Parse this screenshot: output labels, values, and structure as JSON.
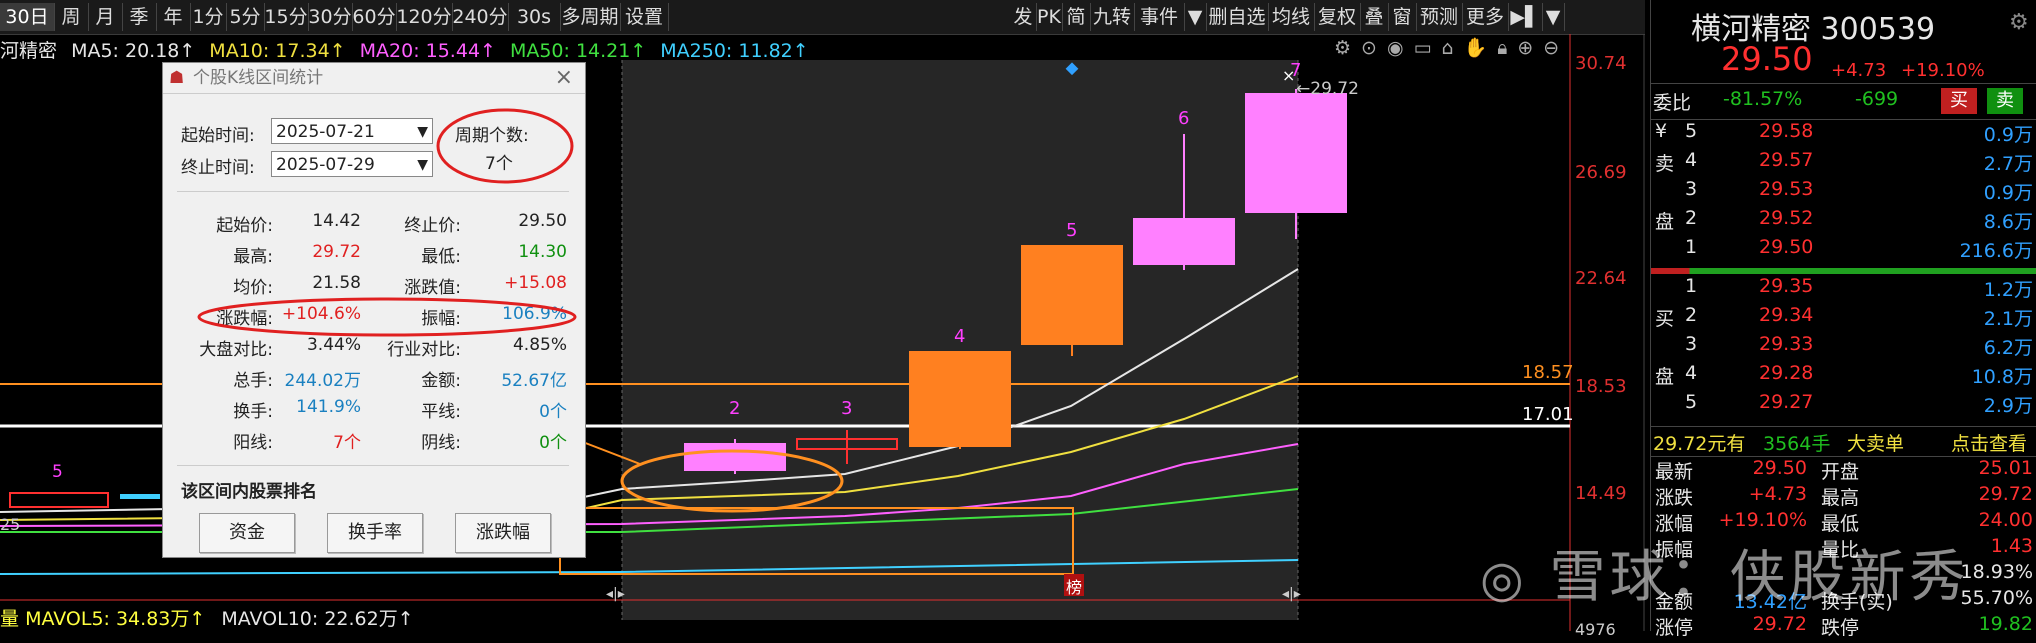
{
  "toolbar": {
    "left": [
      "30日",
      "周",
      "月",
      "季",
      "年",
      "1分",
      "5分",
      "15分",
      "30分",
      "60分",
      "120分",
      "240分",
      "30s",
      "多周期",
      "设置"
    ],
    "active": "30日",
    "right": [
      "发",
      "PK",
      "简",
      "九转",
      "事件",
      "▼",
      "删自选",
      "均线",
      "复权",
      "叠",
      "窗",
      "预测",
      "更多",
      "▶▌",
      "▼"
    ]
  },
  "ma": [
    {
      "label": "MA5: 20.18↑",
      "color": "#e6e6e6"
    },
    {
      "label": "MA10: 17.34↑",
      "color": "#f0e040"
    },
    {
      "label": "MA20: 15.44↑",
      "color": "#ff60ff"
    },
    {
      "label": "MA50: 14.21↑",
      "color": "#40e040"
    },
    {
      "label": "MA250: 11.82↑",
      "color": "#40d0ff"
    }
  ],
  "stock_short": "河精密",
  "axis": {
    "price_ticks": [
      "30.74",
      "26.69",
      "22.64",
      "18.53",
      "14.49"
    ],
    "line_labels": [
      "18.57",
      "17.01"
    ],
    "high_annotation": "29.72",
    "left_partial": "25",
    "bottom_tick": "4976",
    "left_candle_label": "5"
  },
  "candles": {
    "labels": [
      "2",
      "3",
      "4",
      "5",
      "6",
      "7"
    ],
    "board_tag": "榜",
    "bottom_markers": [
      "◂|▸",
      "◂|▸",
      "◂|▸"
    ]
  },
  "volume": {
    "prefix": "量",
    "mavol5": "MAVOL5: 34.83万↑",
    "mavol10": "MAVOL10: 22.62万↑"
  },
  "popup": {
    "title": "个股K线区间统计",
    "start_label": "起始时间:",
    "start_value": "2025-07-21",
    "end_label": "终止时间:",
    "end_value": "2025-07-29",
    "period_label": "周期个数:",
    "period_value": "7个",
    "stats": [
      {
        "l1": "起始价:",
        "v1": "14.42",
        "c1": "#222",
        "l2": "终止价:",
        "v2": "29.50",
        "c2": "#222"
      },
      {
        "l1": "最高:",
        "v1": "29.72",
        "c1": "#e02020",
        "l2": "最低:",
        "v2": "14.30",
        "c2": "#109010"
      },
      {
        "l1": "均价:",
        "v1": "21.58",
        "c1": "#222",
        "l2": "涨跌值:",
        "v2": "+15.08",
        "c2": "#e02020"
      },
      {
        "l1": "涨跌幅:",
        "v1": "+104.6%",
        "c1": "#e02020",
        "l2": "振幅:",
        "v2": "106.9%",
        "c2": "#1a80c0"
      },
      {
        "l1": "大盘对比:",
        "v1": "3.44%",
        "c1": "#222",
        "l2": "行业对比:",
        "v2": "4.85%",
        "c2": "#222"
      },
      {
        "l1": "总手:",
        "v1": "244.02万",
        "c1": "#1a80c0",
        "l2": "金额:",
        "v2": "52.67亿",
        "c2": "#1a80c0"
      },
      {
        "l1": "换手:",
        "v1": "141.9%",
        "c1": "#1a80c0",
        "l2": "平线:",
        "v2": "0个",
        "c2": "#1a80c0"
      },
      {
        "l1": "阳线:",
        "v1": "7个",
        "c1": "#e02020",
        "l2": "阴线:",
        "v2": "0个",
        "c2": "#109010"
      }
    ],
    "rank_title": "该区间内股票排名",
    "buttons": [
      "资金",
      "换手率",
      "涨跌幅"
    ]
  },
  "quote": {
    "name": "横河精密",
    "code": "300539",
    "price": "29.50",
    "change": "+4.73",
    "pct": "+19.10%",
    "weibi_label": "委比",
    "weibi_pct": "-81.57%",
    "weibi_num": "-699",
    "sell_btn": "买",
    "buy_btn": "卖",
    "sell_side_chars": [
      "¥",
      "卖",
      "",
      "盘",
      ""
    ],
    "buy_side_chars": [
      "",
      "买",
      "",
      "盘",
      ""
    ],
    "asks": [
      {
        "n": "5",
        "p": "29.58",
        "v": "0.9万"
      },
      {
        "n": "4",
        "p": "29.57",
        "v": "2.7万"
      },
      {
        "n": "3",
        "p": "29.53",
        "v": "0.9万"
      },
      {
        "n": "2",
        "p": "29.52",
        "v": "8.6万"
      },
      {
        "n": "1",
        "p": "29.50",
        "v": "216.6万"
      }
    ],
    "bids": [
      {
        "n": "1",
        "p": "29.35",
        "v": "1.2万"
      },
      {
        "n": "2",
        "p": "29.34",
        "v": "2.1万"
      },
      {
        "n": "3",
        "p": "29.33",
        "v": "6.2万"
      },
      {
        "n": "4",
        "p": "29.28",
        "v": "10.8万"
      },
      {
        "n": "5",
        "p": "29.27",
        "v": "2.9万"
      }
    ],
    "big_order": {
      "price": "29.72元有",
      "qty": "3564手",
      "type": "大卖单",
      "link": "点击查看"
    },
    "stats": [
      {
        "l1": "最新",
        "v1": "29.50",
        "c1": "#ff3030",
        "l2": "开盘",
        "v2": "25.01",
        "c2": "#ff3030"
      },
      {
        "l1": "涨跌",
        "v1": "+4.73",
        "c1": "#ff3030",
        "l2": "最高",
        "v2": "29.72",
        "c2": "#ff3030"
      },
      {
        "l1": "涨幅",
        "v1": "+19.10%",
        "c1": "#ff3030",
        "l2": "最低",
        "v2": "24.00",
        "c2": "#ff3030"
      },
      {
        "l1": "振幅",
        "v1": "",
        "c1": "#e6e6e6",
        "l2": "量比",
        "v2": "1.43",
        "c2": "#ff3030"
      },
      {
        "l1": "",
        "v1": "",
        "c1": "#e6e6e6",
        "l2": "",
        "v2": "18.93%",
        "c2": "#e6e6e6"
      },
      {
        "l1": "金额",
        "v1": "13.42亿",
        "c1": "#30a0ff",
        "l2": "换手(实)",
        "v2": "55.70%",
        "c2": "#e6e6e6"
      },
      {
        "l1": "涨停",
        "v1": "29.72",
        "c1": "#ff3030",
        "l2": "跌停",
        "v2": "19.82",
        "c2": "#20c020"
      }
    ]
  },
  "watermark": "雪球：侠股新秀",
  "colors": {
    "up": "#ff8020",
    "up_pink": "#ff80ff",
    "red": "#ff3030",
    "green": "#20c020",
    "axis_red": "#e03030"
  }
}
